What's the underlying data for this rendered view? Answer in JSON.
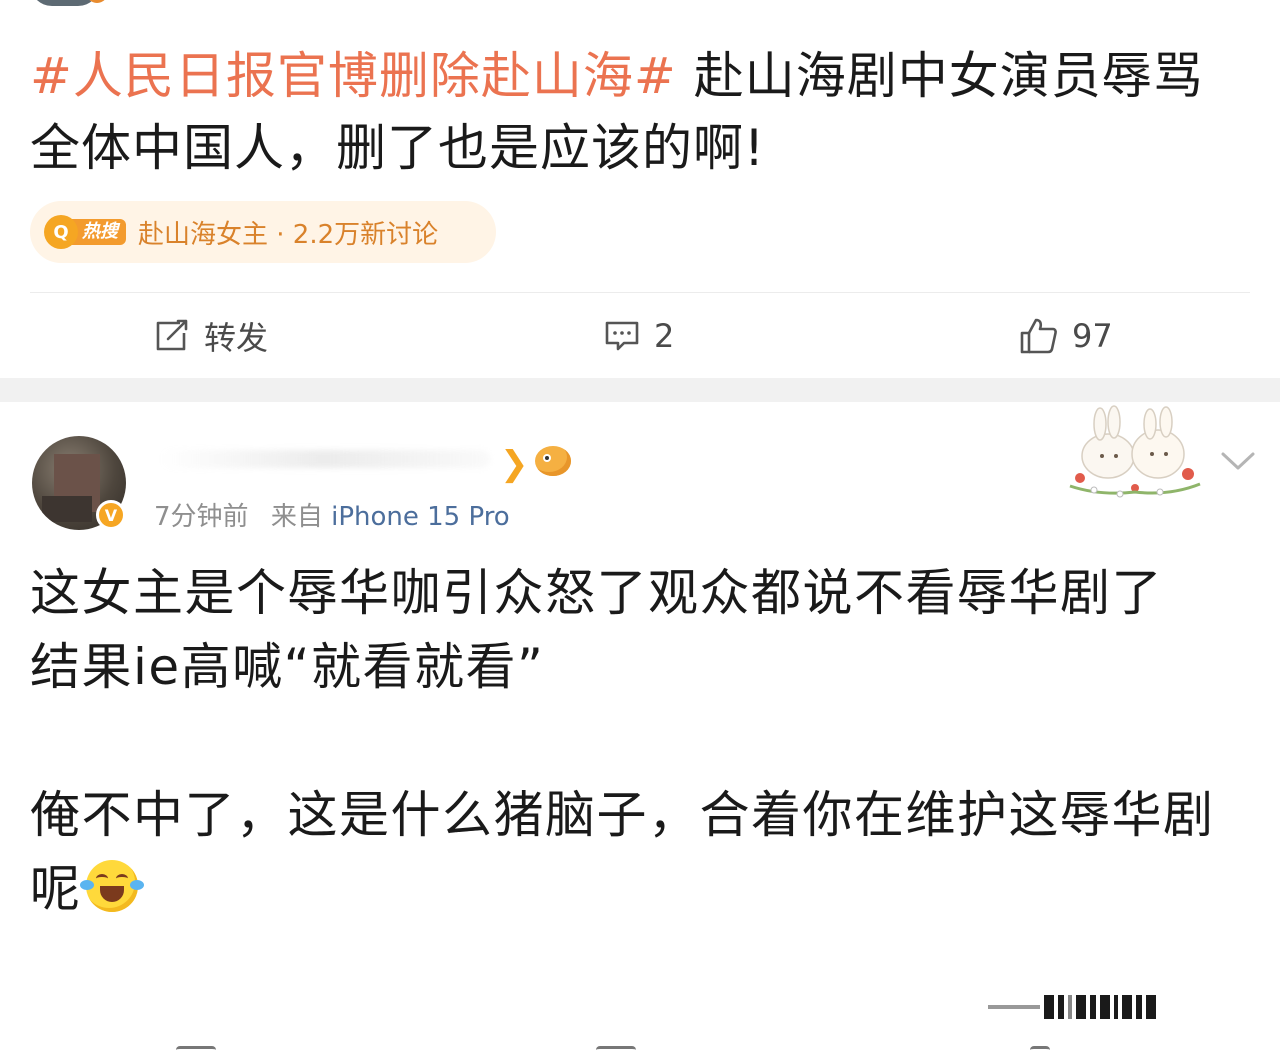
{
  "post1": {
    "hashtag": "#人民日报官博删除赴山海#",
    "body": " 赴山海剧中女演员辱骂全体中国人，删了也是应该的啊!",
    "hot_search": {
      "icon_label": "热搜",
      "text": "赴山海女主 · 2.2万新讨论"
    },
    "actions": {
      "repost_label": "转发",
      "comments_count": "2",
      "likes_count": "97"
    }
  },
  "post2": {
    "time": "7分钟前",
    "source_prefix": "来自",
    "device": "iPhone 15 Pro",
    "vip_badge": "V",
    "body_text": "这女主是个辱华咖引众怒了观众都说不看辱华剧了\n结果ie高喊“就看就看”\n\n俺不中了，这是什么猪脑子，合着你在维护这辱华剧呢"
  },
  "colors": {
    "hashtag": "#eb7350",
    "hot_chip_bg": "#fff4e6",
    "hot_text": "#d9822b",
    "device_link": "#4c6e9c",
    "meta_gray": "#8f8f8f",
    "separator": "#f1f1f1"
  },
  "icons": [
    "repost-icon",
    "comment-icon",
    "like-icon",
    "search-icon",
    "verified-icon",
    "chevron-down-icon",
    "laugh-cry-emoji"
  ]
}
